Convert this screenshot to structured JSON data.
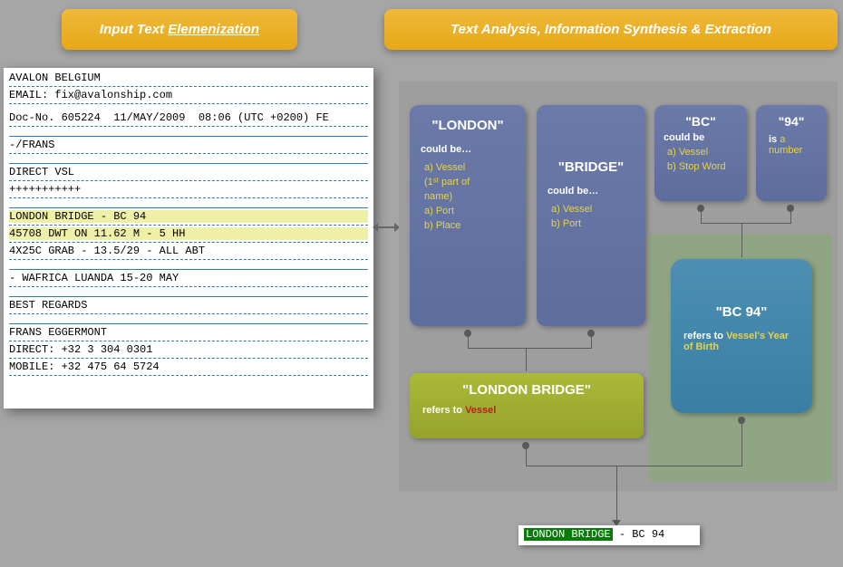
{
  "headers": {
    "left_pre": "Input Text ",
    "left_underlined": "Elemenization",
    "right": "Text Analysis, Information Synthesis & Extraction"
  },
  "input_text": {
    "l1": "AVALON BELGIUM",
    "l2": "EMAIL: fix@avalonship.com",
    "l3": "Doc-No. 605224  11/MAY/2009  08:06 (UTC +0200) FE",
    "l4": "-/FRANS",
    "l5": "DIRECT VSL",
    "l6": "+++++++++++",
    "l7": "LONDON BRIDGE - BC 94",
    "l8": "45708 DWT ON 11.62 M - 5 HH",
    "l9": "4X25C GRAB - 13.5/29 - ALL ABT",
    "l10": "- WAFRICA LUANDA 15-20 MAY",
    "l11": "BEST REGARDS",
    "l12": "FRANS EGGERMONT",
    "l13": "DIRECT: +32 3 304 0301",
    "l14": "MOBILE: +32 475 64 5724"
  },
  "cards": {
    "london": {
      "title": "\"LONDON\"",
      "sub": "could be…",
      "opt1": "a)  Vessel",
      "opt1b": "     (1ˢᵗ part of",
      "opt1c": "     name)",
      "opt2": "a)  Port",
      "opt3": "b)  Place"
    },
    "bridge": {
      "title": "\"BRIDGE\"",
      "sub": "could be…",
      "opt1": "a)  Vessel",
      "opt2": "b)  Port"
    },
    "bc": {
      "title": "\"BC\"",
      "sub": "could be",
      "opt1": "a)  Vessel",
      "opt2": "b)  Stop Word"
    },
    "n94": {
      "title": "\"94\"",
      "pre": "is ",
      "hl": "a number"
    },
    "london_bridge": {
      "title": "\"LONDON BRIDGE\"",
      "pre": "refers to ",
      "red": "Vessel"
    },
    "bc94": {
      "title": "\"BC 94\"",
      "pre": "refers to ",
      "hl": "Vessel's Year of Birth"
    }
  },
  "result": {
    "green": "LONDON BRIDGE",
    "rest": " - BC 94"
  }
}
